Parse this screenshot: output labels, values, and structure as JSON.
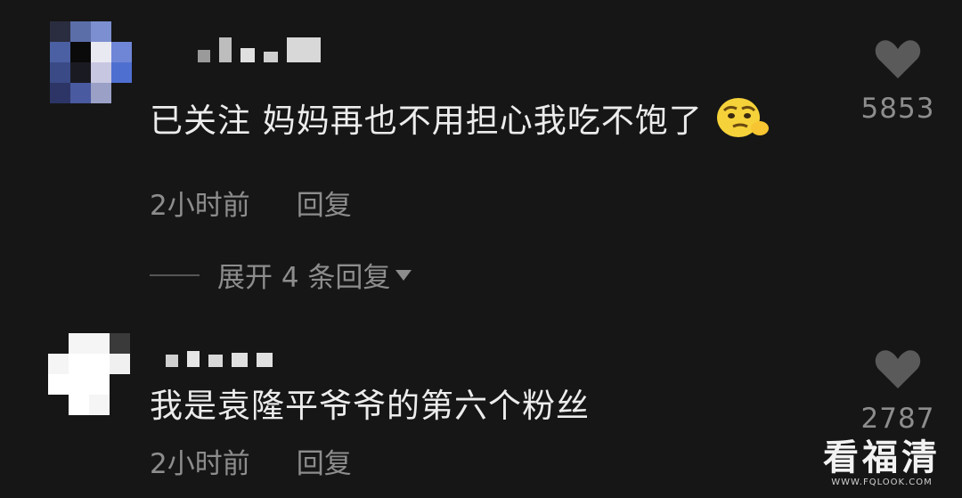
{
  "colors": {
    "background": "#161616",
    "text_primary": "#ececec",
    "text_secondary": "#8d8d8d",
    "heart": "#5a5a5a"
  },
  "comments": [
    {
      "text": "已关注 妈妈再也不用担心我吃不饱了",
      "emoji": "smirk-emoji-icon",
      "time": "2小时前",
      "reply_label": "回复",
      "expand_label": "展开 4 条回复",
      "likes": "5853",
      "like_icon": "heart-icon"
    },
    {
      "text": "我是袁隆平爷爷的第六个粉丝",
      "time": "2小时前",
      "reply_label": "回复",
      "likes": "2787",
      "like_icon": "heart-icon"
    }
  ],
  "watermark": {
    "main": "看福清",
    "sub": "WWW.FQLOOK.COM"
  }
}
